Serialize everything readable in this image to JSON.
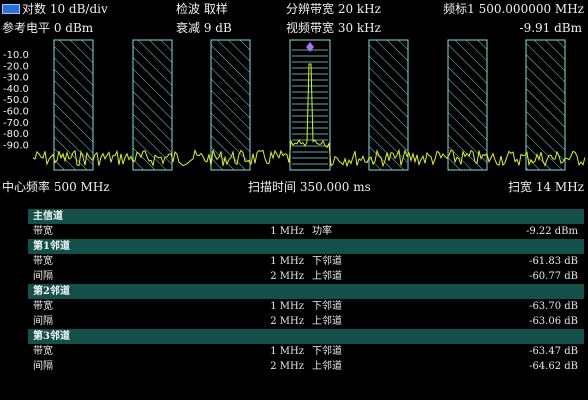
{
  "header": {
    "row1": {
      "scale": "对数  10 dB/div",
      "detector": "检波  取样",
      "rbw": "分辨带宽  20 kHz",
      "marker": "频标1  500.000000 MHz"
    },
    "row2": {
      "ref_level": "参考电平  0 dBm",
      "atten": "衰减  9 dB",
      "vbw": "视频带宽  30 kHz",
      "marker_level": "-9.91 dBm"
    }
  },
  "plot": {
    "y_ticks": [
      "-10.0",
      "-20.0",
      "-30.0",
      "-40.0",
      "-50.0",
      "-60.0",
      "-70.0",
      "-80.0",
      "-90.0"
    ],
    "marker_color": "#b070ff",
    "trace_color": "#e0f020",
    "channel_color": "#7fe0dc"
  },
  "footer": {
    "center": "中心频率  500 MHz",
    "sweep": "扫描时间  350.000 ms",
    "span": "扫宽  14 MHz"
  },
  "acp": {
    "main": {
      "title": "主信道",
      "rows": [
        {
          "label": "带宽",
          "value": "1 MHz",
          "name": "功率",
          "result": "-9.22 dBm"
        }
      ]
    },
    "adjacent": [
      {
        "title": "第1邻道",
        "rows": [
          {
            "label": "带宽",
            "value": "1 MHz",
            "name": "下邻道",
            "result": "-61.83 dB"
          },
          {
            "label": "间隔",
            "value": "2 MHz",
            "name": "上邻道",
            "result": "-60.77 dB"
          }
        ]
      },
      {
        "title": "第2邻道",
        "rows": [
          {
            "label": "带宽",
            "value": "1 MHz",
            "name": "下邻道",
            "result": "-63.70 dB"
          },
          {
            "label": "间隔",
            "value": "2 MHz",
            "name": "上邻道",
            "result": "-63.06 dB"
          }
        ]
      },
      {
        "title": "第3邻道",
        "rows": [
          {
            "label": "带宽",
            "value": "1 MHz",
            "name": "下邻道",
            "result": "-63.47 dB"
          },
          {
            "label": "间隔",
            "value": "2 MHz",
            "name": "上邻道",
            "result": "-64.62 dB"
          }
        ]
      }
    ]
  }
}
